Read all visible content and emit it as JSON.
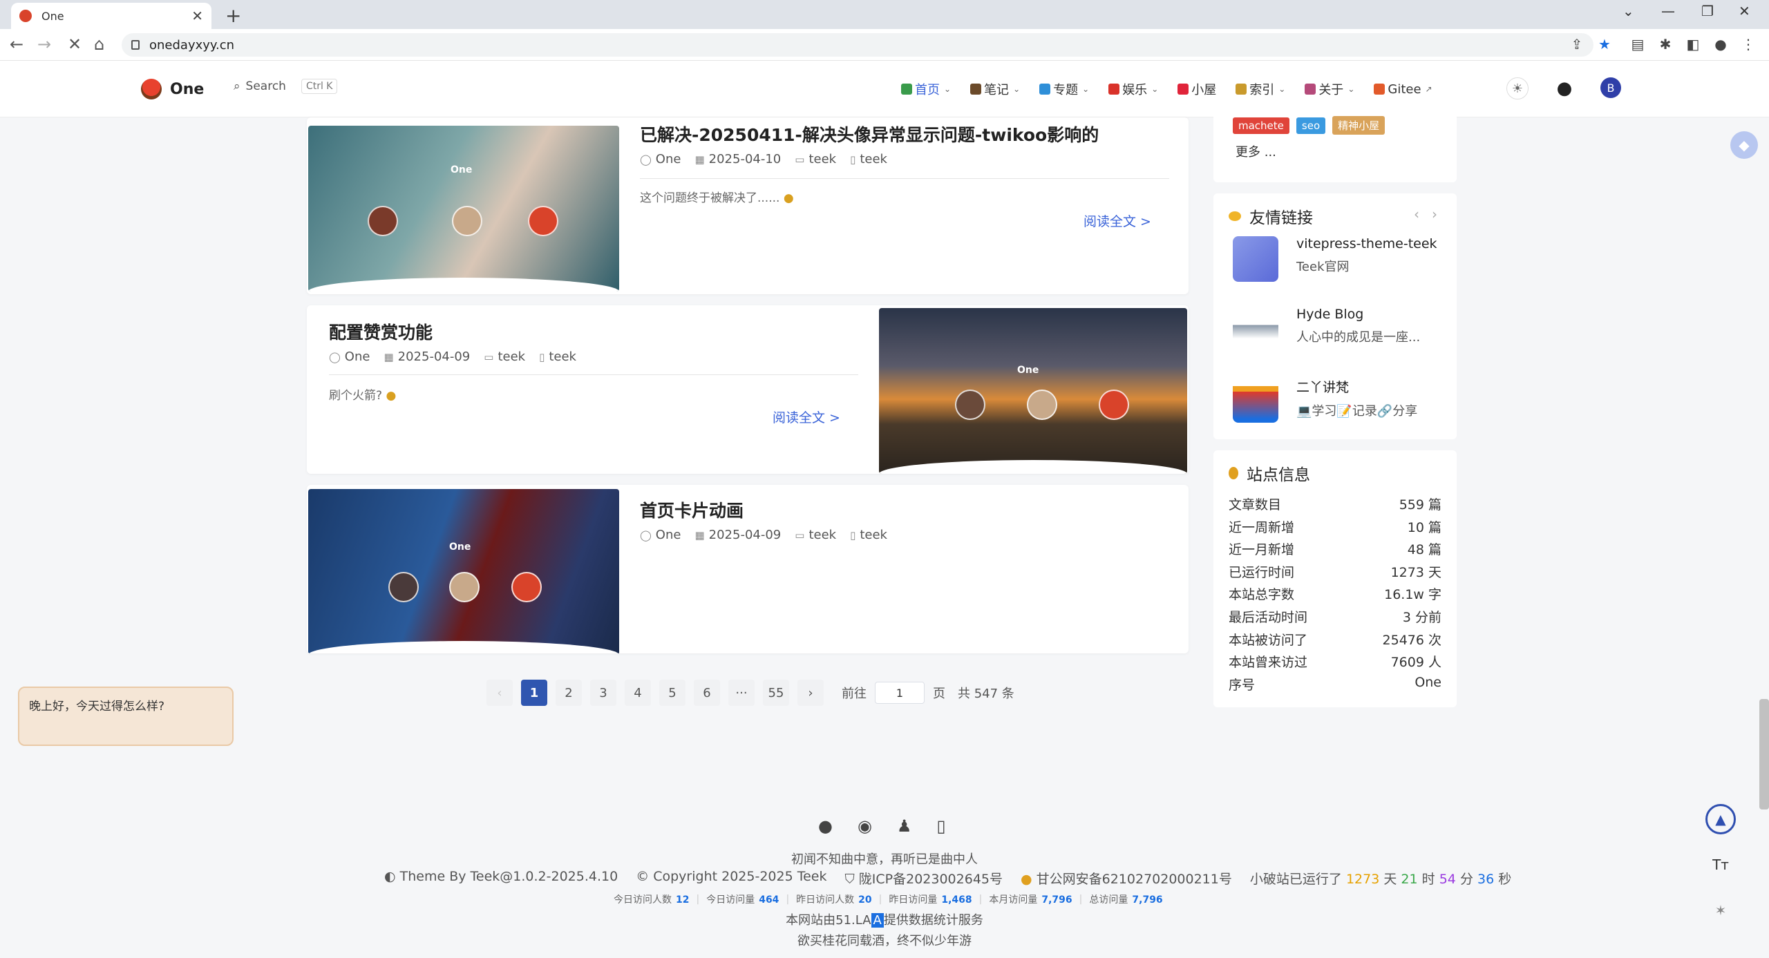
{
  "browser": {
    "tab_title": "One",
    "url": "onedayxyy.cn",
    "close": "✕",
    "new_tab": "+",
    "back": "←",
    "forward": "→",
    "reload": "✕",
    "home": "⌂"
  },
  "site": {
    "logo_name": "One",
    "search_label": "Search",
    "search_kbd": "Ctrl K",
    "menu": [
      {
        "label": "首页",
        "color": "#3a9b4b",
        "dropdown": true,
        "active": true
      },
      {
        "label": "笔记",
        "color": "#6b4a2a",
        "dropdown": true,
        "active": false
      },
      {
        "label": "专题",
        "color": "#2f8fd8",
        "dropdown": true,
        "active": false
      },
      {
        "label": "娱乐",
        "color": "#d9322a",
        "dropdown": true,
        "active": false
      },
      {
        "label": "小屋",
        "color": "#e0243a",
        "dropdown": false,
        "active": false
      },
      {
        "label": "索引",
        "color": "#c99a2c",
        "dropdown": true,
        "active": false
      },
      {
        "label": "关于",
        "color": "#b54a7a",
        "dropdown": true,
        "active": false
      },
      {
        "label": "Gitee",
        "color": "#e25a2a",
        "dropdown": false,
        "external": "↗",
        "active": false
      }
    ],
    "avatar_letter": "B"
  },
  "posts": [
    {
      "title": "已解决-20250411-解决头像异常显示问题-twikoo影响的",
      "author": "One",
      "date": "2025-04-10",
      "category": "teek",
      "tag": "teek",
      "excerpt": "这个问题终于被解决了......",
      "read_more": "阅读全文 >",
      "thumb_label": "One"
    },
    {
      "title": "配置赞赏功能",
      "author": "One",
      "date": "2025-04-09",
      "category": "teek",
      "tag": "teek",
      "excerpt": "刷个火箭?",
      "read_more": "阅读全文 >",
      "thumb_label": "One"
    },
    {
      "title": "首页卡片动画",
      "author": "One",
      "date": "2025-04-09",
      "category": "teek",
      "tag": "teek",
      "thumb_label": "One"
    }
  ],
  "pagination": {
    "prev": "‹",
    "pages": [
      "1",
      "2",
      "3",
      "4",
      "5",
      "6",
      "···",
      "55"
    ],
    "next": "›",
    "goto_prefix": "前往",
    "goto_value": "1",
    "goto_suffix": "页",
    "total": "共 547 条"
  },
  "sidebar": {
    "tags": [
      {
        "label": "machete",
        "color": "#e0443a"
      },
      {
        "label": "seo",
        "color": "#3a9ae0"
      },
      {
        "label": "精神小屋",
        "color": "#d9a35a"
      }
    ],
    "more": "更多 ...",
    "friends_title": "友情链接",
    "friends_nav": [
      "‹",
      "›"
    ],
    "friends": [
      {
        "name": "vitepress-theme-teek",
        "desc": "Teek官网",
        "color": "#6a7ae0"
      },
      {
        "name": "Hyde Blog",
        "desc": "人心中的成见是一座...",
        "color": "#9aa8b8"
      },
      {
        "name": "二丫讲梵",
        "desc": "💻学习📝记录🔗分享",
        "color": "#e03a2a"
      }
    ],
    "stats_title": "站点信息",
    "stats": [
      {
        "label": "文章数目",
        "value": "559 篇"
      },
      {
        "label": "近一周新增",
        "value": "10 篇"
      },
      {
        "label": "近一月新增",
        "value": "48 篇"
      },
      {
        "label": "已运行时间",
        "value": "1273 天"
      },
      {
        "label": "本站总字数",
        "value": "16.1w 字"
      },
      {
        "label": "最后活动时间",
        "value": "3 分前"
      },
      {
        "label": "本站被访问了",
        "value": "25476 次"
      },
      {
        "label": "本站曾来访过",
        "value": "7609 人"
      },
      {
        "label": "序号",
        "value": "One"
      }
    ]
  },
  "greeting": "晚上好，今天过得怎么样?",
  "footer": {
    "motto": "初闻不知曲中意，再听已是曲中人",
    "theme": "Theme By Teek@1.0.2-2025.4.10",
    "copyright": "Copyright 2025-2025 Teek",
    "icp": "陇ICP备2023002645号",
    "police": "甘公网安备62102702000211号",
    "runtime_prefix": "小破站已运行了",
    "runtime_days": "1273",
    "runtime_days_unit": "天",
    "runtime_hours": "21",
    "runtime_hours_unit": "时",
    "runtime_minutes": "54",
    "runtime_minutes_unit": "分",
    "runtime_seconds": "36",
    "runtime_seconds_unit": "秒",
    "visits": [
      {
        "label": "今日访问人数",
        "value": "12"
      },
      {
        "label": "今日访问量",
        "value": "464"
      },
      {
        "label": "昨日访问人数",
        "value": "20"
      },
      {
        "label": "昨日访问量",
        "value": "1,468"
      },
      {
        "label": "本月访问量",
        "value": "7,796"
      },
      {
        "label": "总访问量",
        "value": "7,796"
      }
    ],
    "stats_service_prefix": "本网站由51.LA",
    "stats_service_badge": "A",
    "stats_service_suffix": "提供数据统计服务",
    "slogan": "欲买桂花同载酒，终不似少年游"
  },
  "floating": {
    "font_btn": "Tт"
  }
}
